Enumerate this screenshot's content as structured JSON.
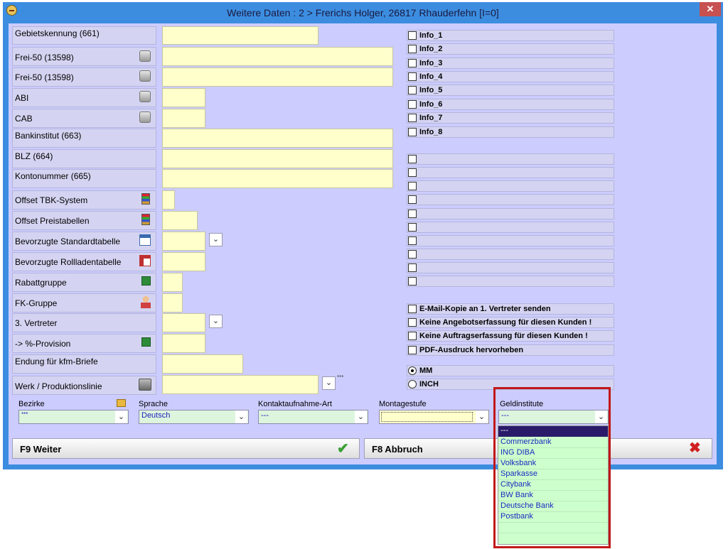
{
  "window": {
    "title": "Weitere Daten : 2 > Frerichs Holger, 26817 Rhauderfehn [I=0]",
    "close_glyph": "✕"
  },
  "left": {
    "gebiet": "Gebietskennung (661)",
    "frei1": "Frei-50 (13598)",
    "frei2": "Frei-50 (13598)",
    "abi": "ABI",
    "cab": "CAB",
    "bankinstitut": "Bankinstitut (663)",
    "blz": "BLZ (664)",
    "konto": "Kontonummer (665)",
    "offset_tbk": "Offset TBK-System",
    "offset_preis": "Offset Preistabellen",
    "std_tabelle": "Bevorzugte Standardtabelle",
    "roll_tabelle": "Bevorzugte Rollladentabelle",
    "rabatt": "Rabattgruppe",
    "fk": "FK-Gruppe",
    "vertreter": "3. Vertreter",
    "provision": "-> %-Provision",
    "endung": "Endung für kfm-Briefe",
    "werk": "Werk / Produktionslinie",
    "werk_suffix": "***"
  },
  "info": [
    "Info_1",
    "Info_2",
    "Info_3",
    "Info_4",
    "Info_5",
    "Info_6",
    "Info_7",
    "Info_8"
  ],
  "options": {
    "email": "E-Mail-Kopie an 1. Vertreter senden",
    "angebot": "Keine Angebotserfassung für diesen Kunden !",
    "auftrag": "Keine Auftragserfassung für diesen Kunden !",
    "pdf": "PDF-Ausdruck hervorheben"
  },
  "units": {
    "mm": "MM",
    "inch": "INCH",
    "selected": "MM"
  },
  "bottom": {
    "bezirke": {
      "label": "Bezirke",
      "value": "***"
    },
    "sprache": {
      "label": "Sprache",
      "value": "Deutsch"
    },
    "kontakt": {
      "label": "Kontaktaufnahme-Art",
      "value": "---"
    },
    "montage": {
      "label": "Montagestufe",
      "value": ""
    },
    "geld": {
      "label": "Geldinstitute",
      "value": "---"
    }
  },
  "geld_options": [
    "---",
    "Commerzbank",
    "ING DIBA",
    "Volksbank",
    "Sparkasse",
    "Citybank",
    "BW Bank",
    "Deutsche Bank",
    "Postbank"
  ],
  "buttons": {
    "weiter": "F9 Weiter",
    "abbruch": "F8 Abbruch"
  },
  "glyphs": {
    "dropdown": "⌄",
    "check": "✔",
    "cross": "✖"
  },
  "colors": {
    "titlebar": "#3c8de0",
    "client": "#ccccff",
    "field": "#ffffcc",
    "accent_red": "#c01818",
    "selected_item": "#2a1a6a"
  }
}
